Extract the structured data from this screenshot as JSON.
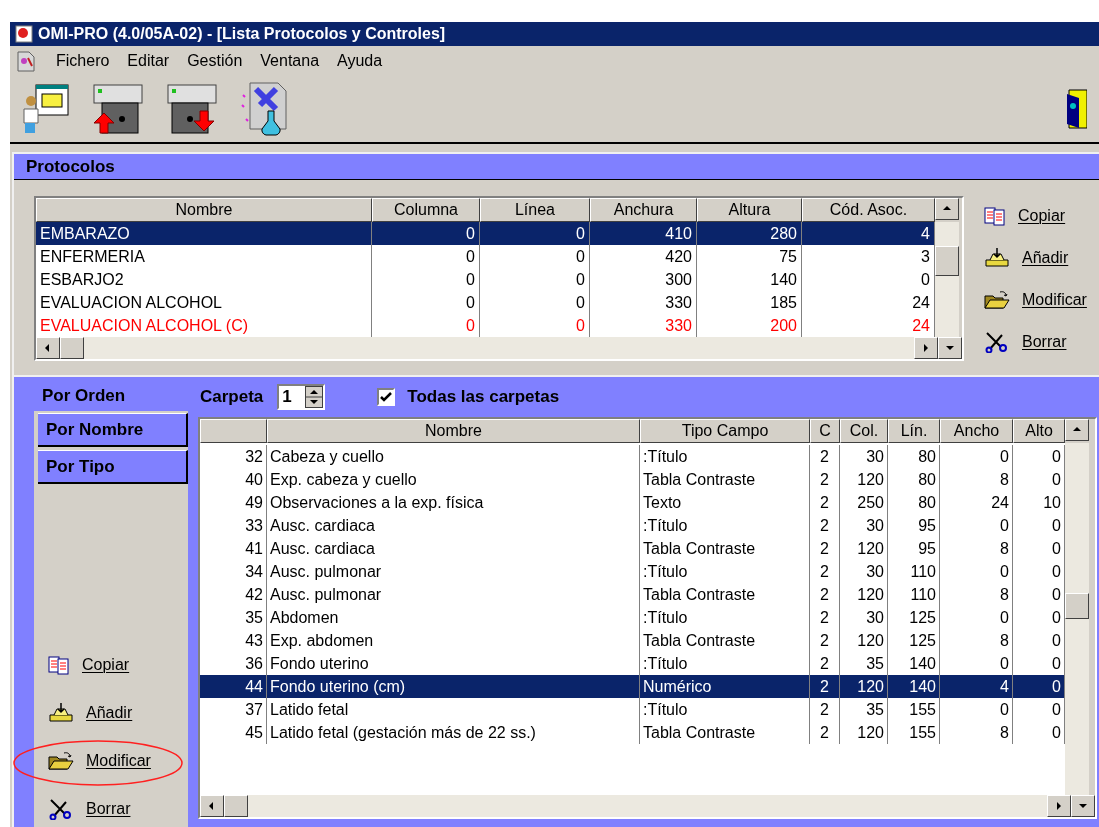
{
  "window": {
    "title": "OMI-PRO (4.0/05A-02) - [Lista Protocolos y Controles]"
  },
  "menu": [
    "Fichero",
    "Editar",
    "Gestión",
    "Ventana",
    "Ayuda"
  ],
  "panel": {
    "title": "Protocolos"
  },
  "protocols": {
    "columns": [
      "Nombre",
      "Columna",
      "Línea",
      "Anchura",
      "Altura",
      "Cód. Asoc."
    ],
    "rows": [
      {
        "cells": [
          "EMBARAZO",
          "0",
          "0",
          "410",
          "280",
          "4"
        ],
        "selected": true
      },
      {
        "cells": [
          "ENFERMERIA",
          "0",
          "0",
          "420",
          "75",
          "3"
        ],
        "selected": false,
        "color": "#000000"
      },
      {
        "cells": [
          "ESBARJO2",
          "0",
          "0",
          "300",
          "140",
          "0"
        ],
        "selected": false,
        "color": "#000000"
      },
      {
        "cells": [
          "EVALUACION ALCOHOL",
          "0",
          "0",
          "330",
          "185",
          "24"
        ],
        "selected": false,
        "color": "#000000"
      },
      {
        "cells": [
          "EVALUACION ALCOHOL (C)",
          "0",
          "0",
          "330",
          "200",
          "24"
        ],
        "selected": false,
        "color": "#ff0000"
      }
    ]
  },
  "protocol_actions": [
    {
      "kind": "copy",
      "label": "Copiar",
      "highlighted": false
    },
    {
      "kind": "add",
      "label": "Añadir",
      "highlighted": false
    },
    {
      "kind": "edit",
      "label": "Modificar",
      "highlighted": false
    },
    {
      "kind": "delete",
      "label": "Borrar",
      "highlighted": false
    }
  ],
  "sort_tabs": [
    {
      "label": "Por Orden",
      "selected": true
    },
    {
      "label": "Por Nombre",
      "selected": false
    },
    {
      "label": "Por Tipo",
      "selected": false
    }
  ],
  "folder": {
    "label": "Carpeta",
    "value": "1"
  },
  "all_folders": {
    "label": "Todas las carpetas",
    "checked": true
  },
  "controls": {
    "columns": [
      "",
      "Nombre",
      "Tipo Campo",
      "C",
      "Col.",
      "Lín.",
      "Ancho",
      "Alto"
    ],
    "rows": [
      {
        "cells": [
          "32",
          "Cabeza y cuello",
          ":Título",
          "2",
          "30",
          "80",
          "0",
          "0"
        ],
        "selected": false
      },
      {
        "cells": [
          "40",
          "Exp. cabeza y cuello",
          "Tabla Contraste",
          "2",
          "120",
          "80",
          "8",
          "0"
        ],
        "selected": false
      },
      {
        "cells": [
          "49",
          "Observaciones a la exp. física",
          "Texto",
          "2",
          "250",
          "80",
          "24",
          "10"
        ],
        "selected": false
      },
      {
        "cells": [
          "33",
          "Ausc. cardiaca",
          ":Título",
          "2",
          "30",
          "95",
          "0",
          "0"
        ],
        "selected": false
      },
      {
        "cells": [
          "41",
          "Ausc. cardiaca",
          "Tabla Contraste",
          "2",
          "120",
          "95",
          "8",
          "0"
        ],
        "selected": false
      },
      {
        "cells": [
          "34",
          "Ausc. pulmonar",
          ":Título",
          "2",
          "30",
          "110",
          "0",
          "0"
        ],
        "selected": false
      },
      {
        "cells": [
          "42",
          "Ausc. pulmonar",
          "Tabla Contraste",
          "2",
          "120",
          "110",
          "8",
          "0"
        ],
        "selected": false
      },
      {
        "cells": [
          "35",
          "Abdomen",
          ":Título",
          "2",
          "30",
          "125",
          "0",
          "0"
        ],
        "selected": false
      },
      {
        "cells": [
          "43",
          "Exp. abdomen",
          "Tabla Contraste",
          "2",
          "120",
          "125",
          "8",
          "0"
        ],
        "selected": false
      },
      {
        "cells": [
          "36",
          "Fondo uterino",
          ":Título",
          "2",
          "35",
          "140",
          "0",
          "0"
        ],
        "selected": false
      },
      {
        "cells": [
          "44",
          "Fondo uterino (cm)",
          "Numérico",
          "2",
          "120",
          "140",
          "4",
          "0"
        ],
        "selected": true
      },
      {
        "cells": [
          "37",
          "Latido fetal",
          ":Título",
          "2",
          "35",
          "155",
          "0",
          "0"
        ],
        "selected": false
      },
      {
        "cells": [
          "45",
          "Latido fetal (gestación más de 22 ss.)",
          "Tabla Contraste",
          "2",
          "120",
          "155",
          "8",
          "0"
        ],
        "selected": false
      }
    ]
  },
  "control_actions": [
    {
      "kind": "copy",
      "label": "Copiar",
      "highlighted": false
    },
    {
      "kind": "add",
      "label": "Añadir",
      "highlighted": false
    },
    {
      "kind": "edit",
      "label": "Modificar",
      "highlighted": true
    },
    {
      "kind": "delete",
      "label": "Borrar",
      "highlighted": false
    }
  ]
}
